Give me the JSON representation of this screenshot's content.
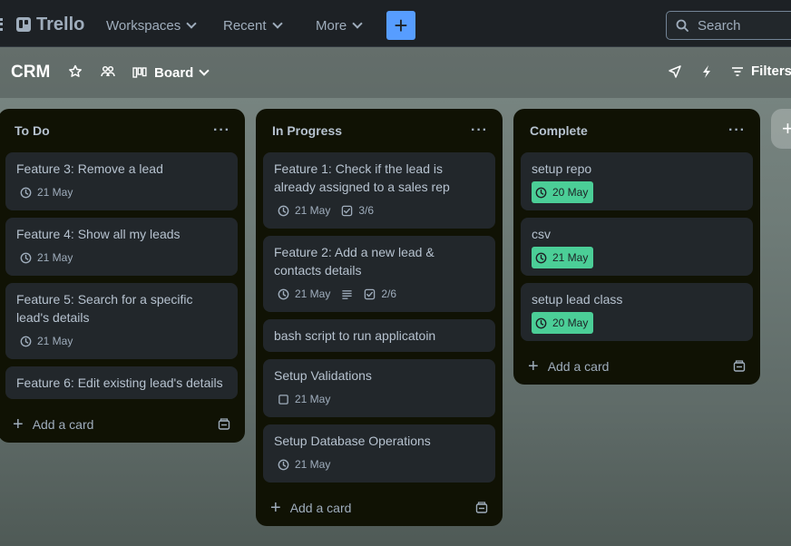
{
  "app": {
    "name": "Trello"
  },
  "topbar": {
    "workspaces": "Workspaces",
    "recent": "Recent",
    "more": "More",
    "create": "+",
    "search_placeholder": "Search"
  },
  "board": {
    "title": "CRM",
    "view": "Board",
    "filters": "Filters"
  },
  "lists": [
    {
      "title": "To Do",
      "menu": "···",
      "add_label": "Add a card",
      "cards": [
        {
          "title": "Feature 3: Remove a lead",
          "date": "21 May"
        },
        {
          "title": "Feature 4: Show all my leads",
          "date": "21 May"
        },
        {
          "title": "Feature 5: Search for a specific lead's details",
          "date": "21 May"
        },
        {
          "title": "Feature 6: Edit existing lead's details"
        }
      ]
    },
    {
      "title": "In Progress",
      "menu": "···",
      "add_label": "Add a card",
      "cards": [
        {
          "title": "Feature 1: Check if the lead is already assigned to a sales rep",
          "date": "21 May",
          "checklist": "3/6"
        },
        {
          "title": "Feature 2: Add a new lead & contacts details",
          "date": "21 May",
          "has_description": true,
          "checklist": "2/6"
        },
        {
          "title": "bash script to run applicatoin"
        },
        {
          "title": "Setup Validations",
          "date": "21 May",
          "date_icon": "checkbox-icon"
        },
        {
          "title": "Setup Database Operations",
          "date": "21 May"
        }
      ]
    },
    {
      "title": "Complete",
      "menu": "···",
      "add_label": "Add a card",
      "cards": [
        {
          "title": "setup repo",
          "date": "20 May",
          "complete": true
        },
        {
          "title": "csv",
          "date": "21 May",
          "complete": true
        },
        {
          "title": "setup lead class",
          "date": "20 May",
          "complete": true
        }
      ]
    }
  ],
  "colors": {
    "topbar_bg": "#1d2125",
    "list_bg": "#101204",
    "card_bg": "#22272b",
    "accent_blue": "#579dff",
    "complete_green": "#4bce97"
  }
}
